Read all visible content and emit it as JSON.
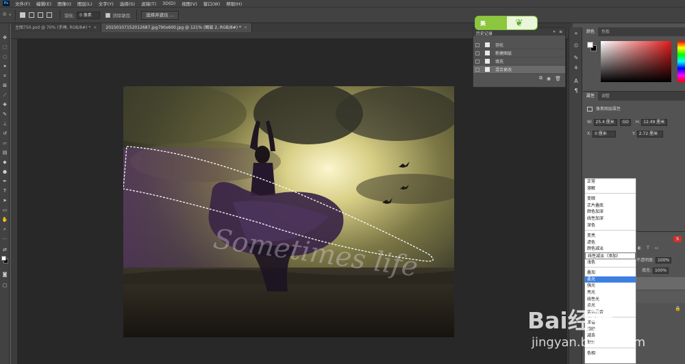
{
  "menu": [
    "文件(F)",
    "编辑(E)",
    "图像(I)",
    "图层(L)",
    "文字(Y)",
    "选择(S)",
    "滤镜(T)",
    "3D(D)",
    "视图(V)",
    "窗口(W)",
    "帮助(H)"
  ],
  "app_badge": "Ps",
  "options": {
    "feather_label": "羽化:",
    "feather_value": "0 像素",
    "antialias_label": "消除锯齿",
    "select_mask_button": "选择并遮住 ..."
  },
  "tabs": [
    {
      "title": "主图750.psd @ 70% (手绳, RGB/8#) *",
      "close": "×"
    },
    {
      "title": "20150107152012687.jpg790x600.jpg @ 121% (图层 2, RGB/8#) *",
      "close": "×"
    }
  ],
  "history": {
    "title": "历史记录",
    "items": [
      {
        "label": "羽化",
        "selected": false
      },
      {
        "label": "新建图层",
        "selected": false
      },
      {
        "label": "填充",
        "selected": false
      },
      {
        "label": "混合更改",
        "selected": true
      }
    ]
  },
  "badge_text": "美",
  "color_panel": {
    "tabs": [
      "颜色",
      "色板"
    ]
  },
  "properties": {
    "tabs": [
      "属性",
      "调整"
    ],
    "title": "像素图层属性",
    "w_label": "W:",
    "w_value": "25.4 厘米",
    "link_symbol": "GO",
    "h_label": "H:",
    "h_value": "12.49 厘米",
    "x_label": "X:",
    "x_value": "0 厘米",
    "y_label": "Y:",
    "y_value": "2.72 厘米"
  },
  "blend_modes": [
    [
      "正常",
      "溶解"
    ],
    [
      "变暗",
      "正片叠底",
      "颜色加深",
      "线性加深",
      "深色"
    ],
    [
      "变亮",
      "滤色",
      "颜色减淡",
      "线性减淡（添加）",
      "浅色"
    ],
    [
      "叠加",
      "柔光",
      "强光",
      "亮光",
      "线性光",
      "点光",
      "实色混合"
    ],
    [
      "差值",
      "排除",
      "减去",
      "划分"
    ],
    [
      "色相"
    ]
  ],
  "blend_selected": "柔光",
  "layers": {
    "opacity_label": "不透明度:",
    "opacity_value": "100%",
    "fill_label": "填充:",
    "fill_value": "100%"
  },
  "watermark": {
    "brand": "Bai经验",
    "url": "jingyan.baidu.com"
  },
  "photo_text": "Sometimes life"
}
